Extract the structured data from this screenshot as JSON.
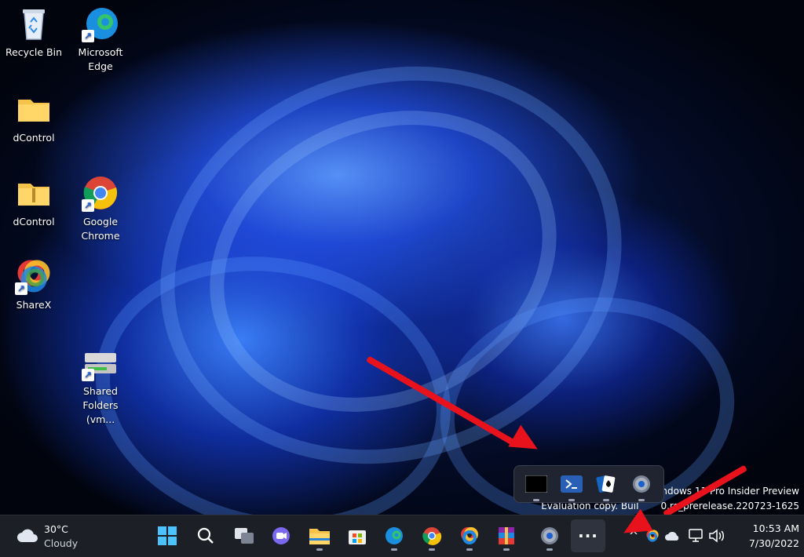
{
  "desktop": {
    "icons": [
      {
        "label": "Recycle Bin",
        "icon": "recycle-bin-icon"
      },
      {
        "label": "Microsoft Edge",
        "icon": "edge-icon"
      },
      {
        "label": "dControl",
        "icon": "folder-icon"
      },
      {
        "label": "dControl",
        "icon": "zip-folder-icon"
      },
      {
        "label": "Google Chrome",
        "icon": "chrome-icon"
      },
      {
        "label": "ShareX",
        "icon": "sharex-icon"
      },
      {
        "label": "Shared Folders (vm...",
        "icon": "network-drive-icon"
      }
    ],
    "watermark": {
      "line1": "indows 11 Pro Insider Preview",
      "line2": "Evaluation copy. Buil",
      "line2b": "0.rs_prerelease.220723-1625"
    }
  },
  "overflow_popup": {
    "items": [
      "terminal-icon",
      "powershell-icon",
      "solitaire-icon",
      "settings-icon"
    ]
  },
  "taskbar": {
    "weather": {
      "temp": "30°C",
      "condition": "Cloudy"
    },
    "apps": [
      "windows-start-icon",
      "search-icon",
      "task-view-icon",
      "teams-chat-icon",
      "file-explorer-icon",
      "store-icon",
      "edge-icon",
      "chrome-icon",
      "sharex-icon",
      "winrar-icon",
      "settings-icon",
      "overflow-more-icon"
    ],
    "overflow_label": "···",
    "tray": {
      "chevron": "^",
      "time": "10:53 AM",
      "date": "7/30/2022"
    }
  },
  "colors": {
    "accent": "#1a5fd8",
    "arrow": "#e8121c",
    "taskbar": "#1c1f26"
  }
}
